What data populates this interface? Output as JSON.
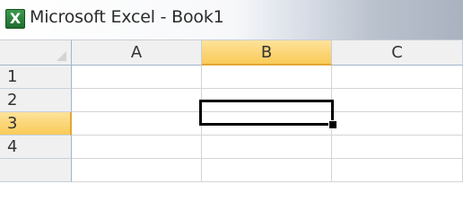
{
  "window": {
    "title": "Microsoft Excel - Book1",
    "icon_letter": "X",
    "icon": "excel-icon"
  },
  "sheet": {
    "columns": [
      "A",
      "B",
      "C"
    ],
    "rows": [
      "1",
      "2",
      "3",
      "4",
      ""
    ],
    "active_column": "B",
    "active_row": "3",
    "selected_cell": "B3"
  },
  "colors": {
    "header_bg": "#f0f0f0",
    "active_header": "#f9cb58",
    "grid_line": "#d4d4d4"
  }
}
